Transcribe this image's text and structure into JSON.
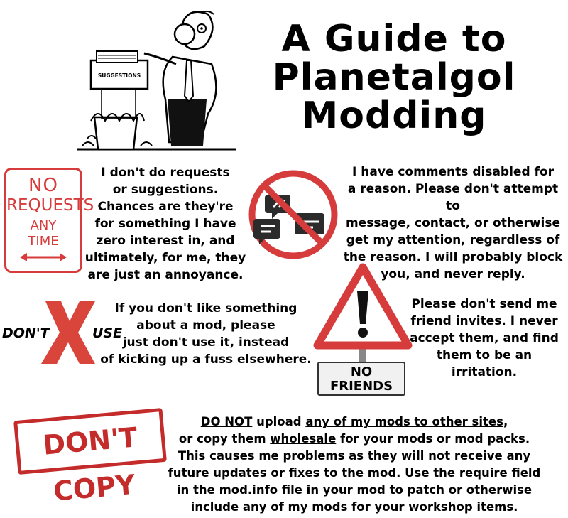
{
  "title": {
    "line1": "A Guide to",
    "line2": "Planetalgol",
    "line3": "Modding"
  },
  "cartoon": {
    "shredder_label": "SUGGESTIONS"
  },
  "requests": {
    "sign": {
      "line1": "NO",
      "line2": "REQUESTS",
      "line3": "ANY",
      "line4": "TIME"
    },
    "text": [
      "I don't do requests",
      "or suggestions.",
      "Chances are they're",
      "for something I have",
      "zero interest in, and",
      "ultimately, for me, they",
      "are just an annoyance."
    ]
  },
  "comments": {
    "text": [
      "I have comments disabled for",
      "a reason. Please don't attempt to",
      "message, contact, or otherwise",
      "get my attention, regardless of",
      "the reason. I will probably block",
      "you, and never reply."
    ]
  },
  "dont_use": {
    "left_word": "DON'T",
    "right_word": "USE",
    "text": [
      "If you don't like something",
      "about a mod, please",
      "just don't use it, instead",
      "of kicking up a fuss elsewhere."
    ]
  },
  "friends": {
    "sign": {
      "line1": "NO",
      "line2": "FRIENDS"
    },
    "text": [
      "Please don't send me",
      "friend invites. I never",
      "accept them, and find",
      "them to be an irritation."
    ]
  },
  "copy": {
    "stamp": "DON'T COPY",
    "line1_underlined_a": "DO NOT",
    "line1_mid": " upload ",
    "line1_underlined_b": "any of my mods to other sites",
    "line1_end": ",",
    "line2_start": "or copy them ",
    "line2_underlined": "wholesale",
    "line2_end": " for your mods or mod packs.",
    "lines": [
      "This causes me problems as they will not receive any",
      "future updates or fixes to the mod. Use the require field",
      "in the mod.info file in your mod to patch or otherwise",
      "include any of my mods for your workshop items."
    ]
  },
  "colors": {
    "red": "#d63c3c",
    "stamp_red": "#c42b2b",
    "x_red": "#d9443b"
  }
}
